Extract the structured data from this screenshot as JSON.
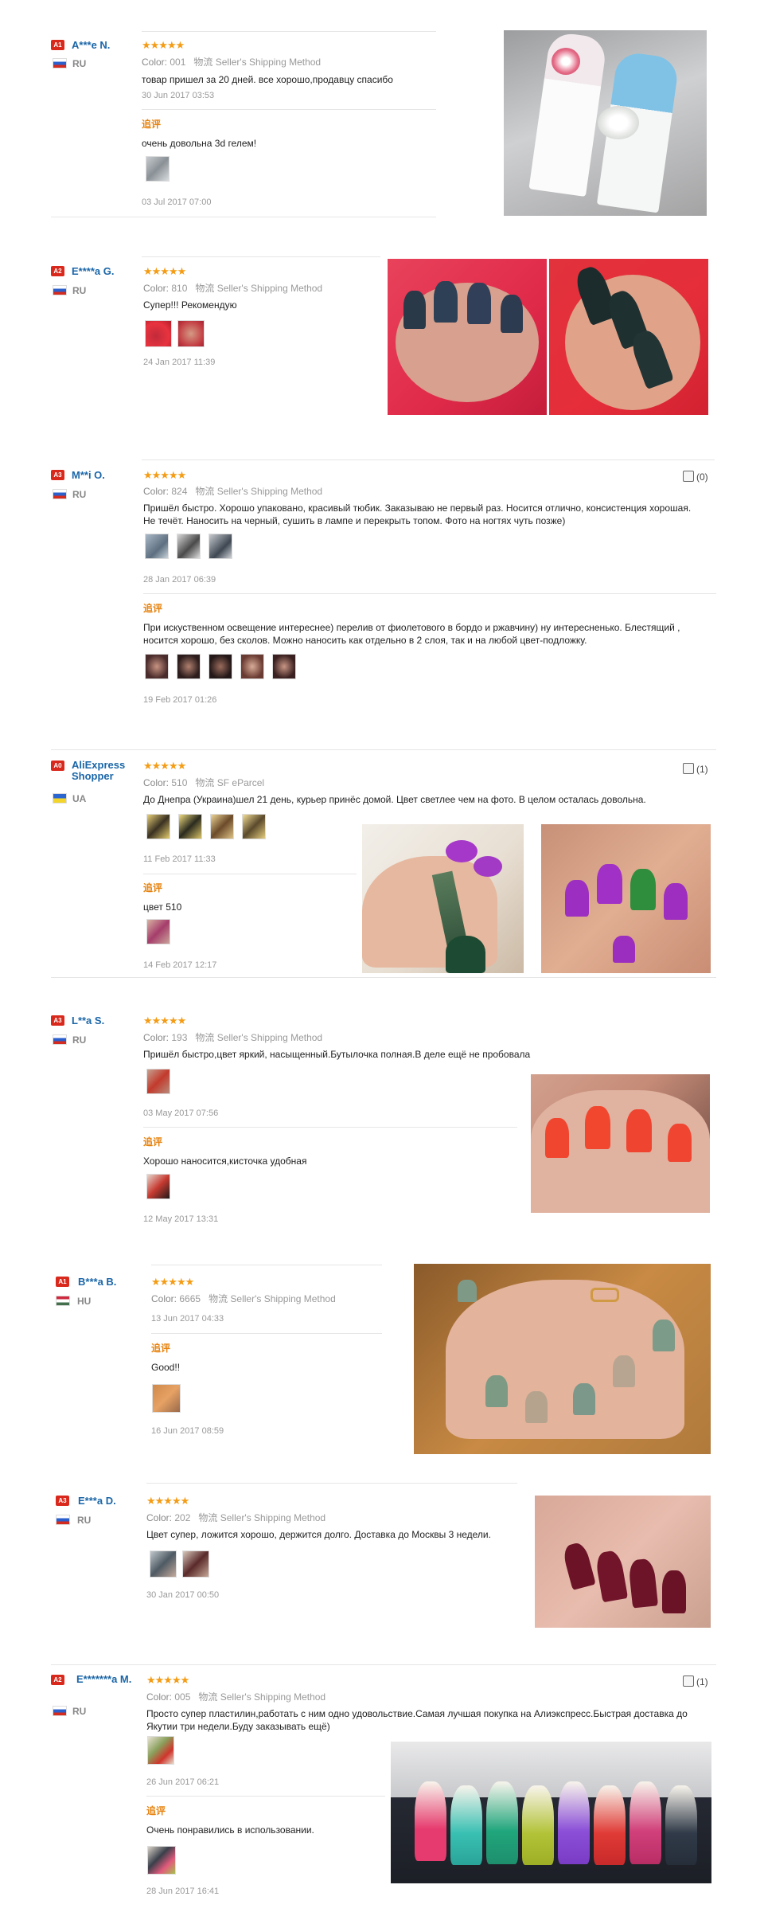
{
  "reviews": [
    {
      "badge": "A1",
      "name": "A***e N.",
      "country": "RU",
      "stars": "★★★★★",
      "color_label": "Color:",
      "color_value": "001",
      "shipping": "物流 Seller's Shipping Method",
      "text": "товар пришел за 20 дней. все хорошо,продавцу спасибо",
      "date": "30 Jun 2017 03:53",
      "followup_label": "追评",
      "followup_text": "очень довольна 3d гелем!",
      "followup_date": "03 Jul 2017 07:00"
    },
    {
      "badge": "A2",
      "name": "E****a G.",
      "country": "RU",
      "stars": "★★★★★",
      "color_label": "Color:",
      "color_value": "810",
      "shipping": "物流 Seller's Shipping Method",
      "text": "Супер!!! Рекомендую",
      "date": "24 Jan 2017 11:39"
    },
    {
      "badge": "A3",
      "name": "M**i O.",
      "country": "RU",
      "stars": "★★★★★",
      "color_label": "Color:",
      "color_value": "824",
      "shipping": "物流 Seller's Shipping Method",
      "helpful": "(0)",
      "text": "Пришёл быстро. Хорошо упаковано, красивый тюбик. Заказываю не первый раз. Носится отлично, консистенция хорошая. Не течёт. Наносить на черный, сушить в лампе и перекрыть топом. Фото на ногтях чуть позже)",
      "date": "28 Jan 2017 06:39",
      "followup_label": "追评",
      "followup_text": "При искуственном освещение интереснее) перелив от фиолетового в бордо и ржавчину) ну интересненько. Блестящий , носится хорошо, без сколов. Можно наносить как отдельно в 2 слоя, так и на любой цвет-подложку.",
      "followup_date": "19 Feb 2017 01:26"
    },
    {
      "badge": "A0",
      "name": "AliExpress Shopper",
      "country": "UA",
      "stars": "★★★★★",
      "color_label": "Color:",
      "color_value": "510",
      "shipping": "物流 SF eParcel",
      "helpful": "(1)",
      "text": "До Днепра (Украина)шел 21 день, курьер принёс домой. Цвет светлее чем на фото. В целом осталась довольна.",
      "date": "11 Feb 2017 11:33",
      "followup_label": "追评",
      "followup_text": "цвет 510",
      "followup_date": "14 Feb 2017 12:17"
    },
    {
      "badge": "A3",
      "name": "L**a S.",
      "country": "RU",
      "stars": "★★★★★",
      "color_label": "Color:",
      "color_value": "193",
      "shipping": "物流 Seller's Shipping Method",
      "text": "Пришёл быстро,цвет яркий, насыщенный.Бутылочка полная.В деле ещё не пробовала",
      "date": "03 May 2017 07:56",
      "followup_label": "追评",
      "followup_text": "Хорошо наносится,кисточка удобная",
      "followup_date": "12 May 2017 13:31"
    },
    {
      "badge": "A1",
      "name": "B***a B.",
      "country": "HU",
      "stars": "★★★★★",
      "color_label": "Color:",
      "color_value": "6665",
      "shipping": "物流 Seller's Shipping Method",
      "date": "13 Jun 2017 04:33",
      "followup_label": "追评",
      "followup_text": "Good!!",
      "followup_date": "16 Jun 2017 08:59"
    },
    {
      "badge": "A3",
      "name": "E***a D.",
      "country": "RU",
      "stars": "★★★★★",
      "color_label": "Color:",
      "color_value": "202",
      "shipping": "物流 Seller's Shipping Method",
      "text": "Цвет супер, ложится хорошо, держится долго. Доставка до Москвы 3 недели.",
      "date": "30 Jan 2017 00:50"
    },
    {
      "badge": "A2",
      "name": "E*******a M.",
      "country": "RU",
      "stars": "★★★★★",
      "color_label": "Color:",
      "color_value": "005",
      "shipping": "物流 Seller's Shipping Method",
      "helpful": "(1)",
      "text": "Просто супер пластилин,работать с ним одно удовольствие.Самая лучшая покупка на Алиэкспресс.Быстрая доставка до Якутии три недели.Буду заказывать ещё)",
      "date": "26 Jun 2017 06:21",
      "followup_label": "追评",
      "followup_text": "Очень понравились в использовании.",
      "followup_date": "28 Jun 2017 16:41"
    }
  ]
}
